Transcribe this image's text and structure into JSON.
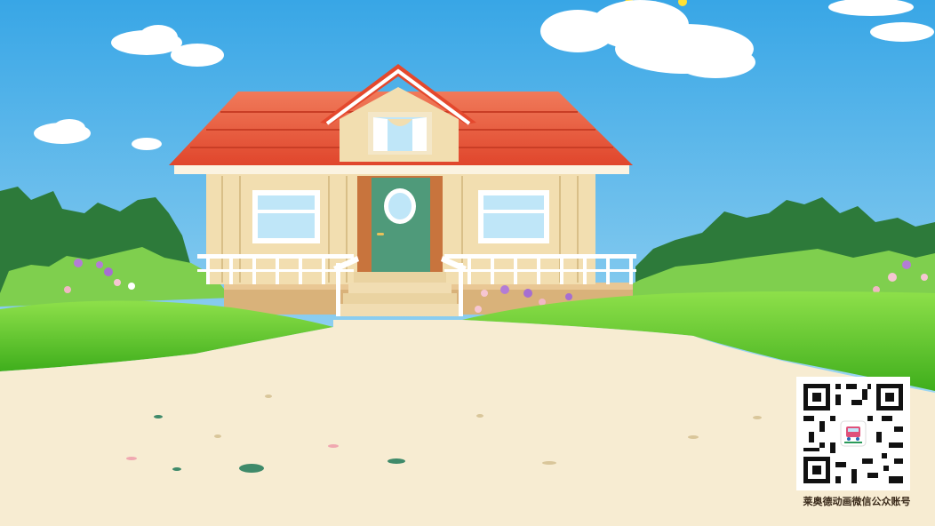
{
  "scene": {
    "subject": "cartoon-house",
    "colors": {
      "sky_top": "#38a6e6",
      "sky_bottom": "#bfe6f6",
      "roof": "#ec5a3c",
      "roof_dark": "#c93e26",
      "wall": "#f2deb0",
      "door": "#4f9a7a",
      "grass": "#5cc72a",
      "path": "#f7ecd2"
    }
  },
  "watermark": {
    "caption": "莱奥德动画微信公众账号",
    "qr_icon": "qr-code-icon",
    "logo_icon": "bus-logo-icon"
  }
}
